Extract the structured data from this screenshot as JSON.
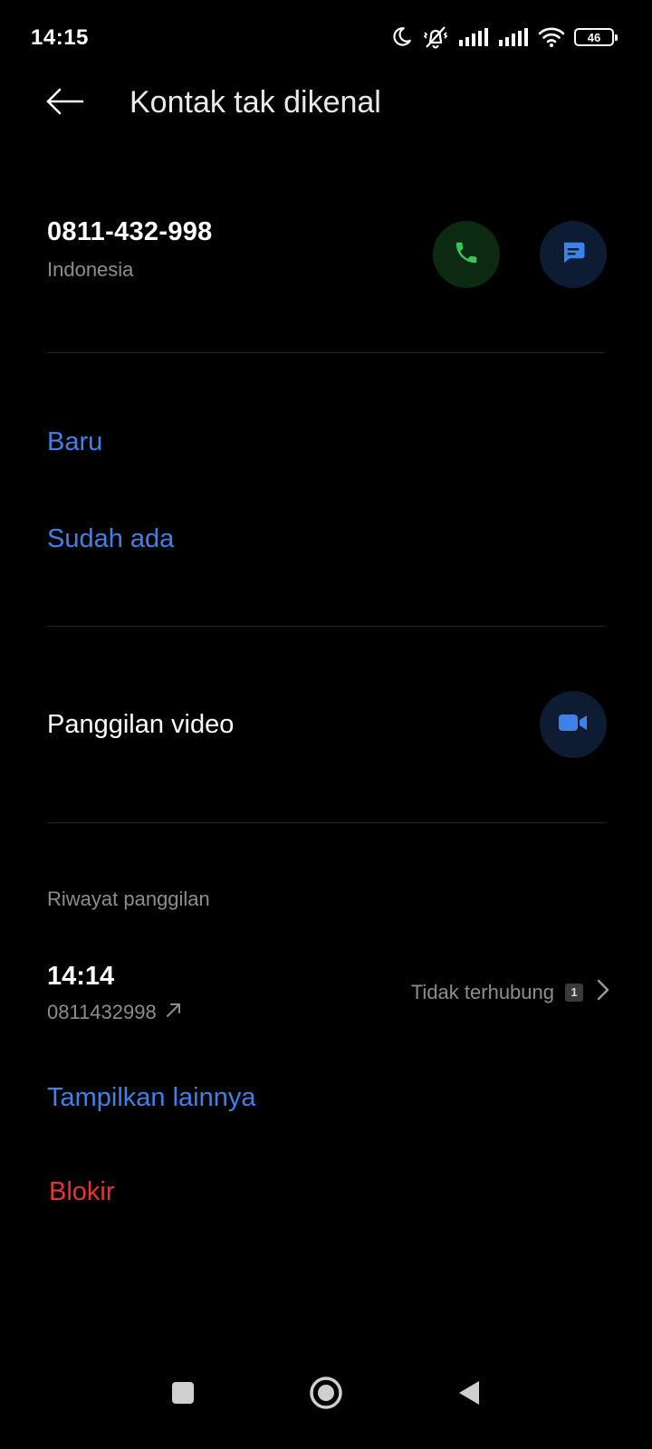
{
  "status_bar": {
    "time": "14:15",
    "battery_level": "46",
    "icons": [
      "moon-icon",
      "vibrate-off-icon",
      "signal-icon",
      "signal-icon",
      "wifi-icon",
      "battery-icon"
    ]
  },
  "header": {
    "title": "Kontak tak dikenal",
    "back_icon": "arrow-left-icon"
  },
  "contact": {
    "number": "0811-432-998",
    "country": "Indonesia",
    "call_icon": "phone-icon",
    "message_icon": "message-icon"
  },
  "add_contact": {
    "new_label": "Baru",
    "existing_label": "Sudah ada"
  },
  "video_call": {
    "label": "Panggilan video",
    "icon": "video-camera-icon"
  },
  "call_history": {
    "section_label": "Riwayat panggilan",
    "entries": [
      {
        "time": "14:14",
        "number": "0811432998",
        "direction_icon": "outgoing-arrow-icon",
        "status": "Tidak terhubung",
        "count": "1"
      }
    ],
    "show_more_label": "Tampilkan lainnya"
  },
  "block": {
    "label": "Blokir"
  },
  "colors": {
    "background": "#000000",
    "accent_blue": "#3d82ea",
    "danger_red": "#e8342f",
    "call_green": "#34c759",
    "secondary_text": "#8d8d8d"
  },
  "nav_bar": {
    "icons": [
      "recent-apps-icon",
      "home-icon",
      "back-icon"
    ]
  }
}
